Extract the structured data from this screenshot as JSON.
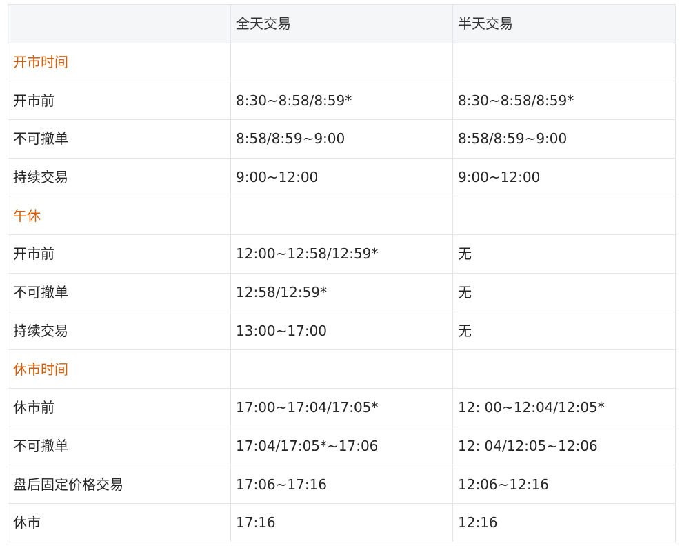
{
  "table": {
    "headers": [
      "",
      "全天交易",
      "半天交易"
    ],
    "rows": [
      {
        "label": "开市时间",
        "full_day": "",
        "half_day": "",
        "section": true
      },
      {
        "label": "开市前",
        "full_day": "8:30~8:58/8:59*",
        "half_day": "8:30~8:58/8:59*",
        "section": false
      },
      {
        "label": "不可撤单",
        "full_day": "8:58/8:59~9:00",
        "half_day": "8:58/8:59~9:00",
        "section": false
      },
      {
        "label": "持续交易",
        "full_day": "9:00~12:00",
        "half_day": "9:00~12:00",
        "section": false
      },
      {
        "label": "午休",
        "full_day": "",
        "half_day": "",
        "section": true
      },
      {
        "label": "开市前",
        "full_day": "12:00~12:58/12:59*",
        "half_day": "无",
        "section": false
      },
      {
        "label": "不可撤单",
        "full_day": "12:58/12:59*",
        "half_day": "无",
        "section": false
      },
      {
        "label": "持续交易",
        "full_day": "13:00~17:00",
        "half_day": "无",
        "section": false
      },
      {
        "label": "休市时间",
        "full_day": "",
        "half_day": "",
        "section": true
      },
      {
        "label": "休市前",
        "full_day": "17:00~17:04/17:05*",
        "half_day": "12: 00~12:04/12:05*",
        "section": false
      },
      {
        "label": "不可撤单",
        "full_day": "17:04/17:05*~17:06",
        "half_day": "12: 04/12:05~12:06",
        "section": false
      },
      {
        "label": "盘后固定价格交易",
        "full_day": "17:06~17:16",
        "half_day": "12:06~12:16",
        "section": false
      },
      {
        "label": "休市",
        "full_day": "17:16",
        "half_day": "12:16",
        "section": false
      }
    ]
  },
  "colors": {
    "section_text": "#d35f0a",
    "header_bg": "#f5f6f8",
    "border": "#e3e5e8",
    "text": "#262626"
  }
}
